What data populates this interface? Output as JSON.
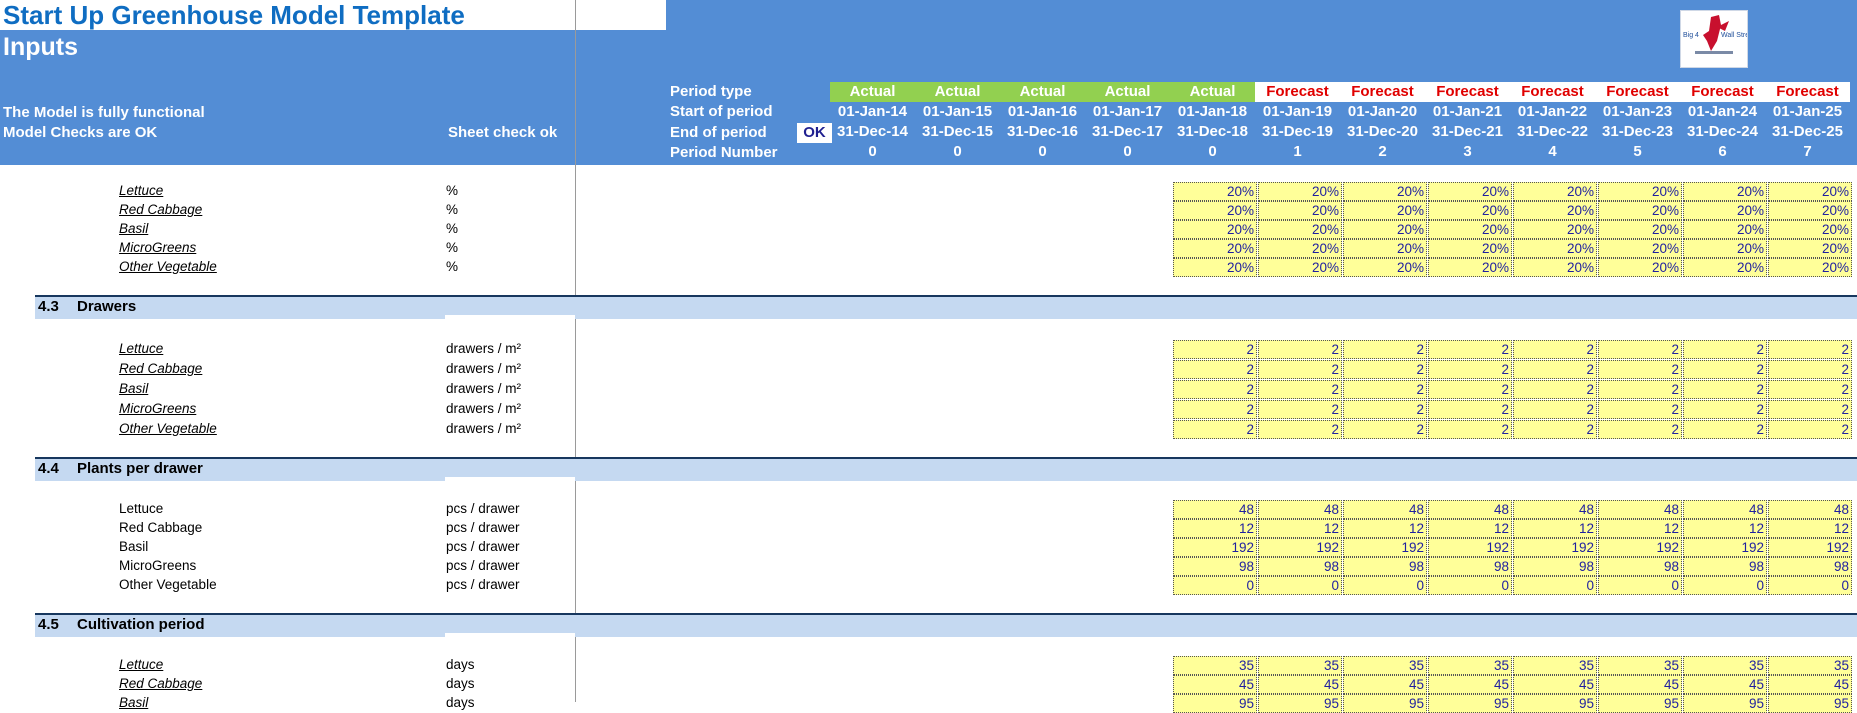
{
  "header": {
    "title": "Start Up Greenhouse Model Template",
    "subtitle": "Inputs",
    "status_line1": "The Model is fully functional",
    "status_line2": "Model Checks are OK",
    "sheet_check": "Sheet check ok",
    "ok_badge": "OK",
    "logo_text": "Big 4 Wall Street"
  },
  "timeline": {
    "row_labels": {
      "period_type": "Period type",
      "start": "Start of period",
      "end": "End of period",
      "number": "Period Number"
    },
    "columns": [
      {
        "type": "Actual",
        "start": "01-Jan-14",
        "end": "31-Dec-14",
        "num": "0"
      },
      {
        "type": "Actual",
        "start": "01-Jan-15",
        "end": "31-Dec-15",
        "num": "0"
      },
      {
        "type": "Actual",
        "start": "01-Jan-16",
        "end": "31-Dec-16",
        "num": "0"
      },
      {
        "type": "Actual",
        "start": "01-Jan-17",
        "end": "31-Dec-17",
        "num": "0"
      },
      {
        "type": "Actual",
        "start": "01-Jan-18",
        "end": "31-Dec-18",
        "num": "0"
      },
      {
        "type": "Forecast",
        "start": "01-Jan-19",
        "end": "31-Dec-19",
        "num": "1"
      },
      {
        "type": "Forecast",
        "start": "01-Jan-20",
        "end": "31-Dec-20",
        "num": "2"
      },
      {
        "type": "Forecast",
        "start": "01-Jan-21",
        "end": "31-Dec-21",
        "num": "3"
      },
      {
        "type": "Forecast",
        "start": "01-Jan-22",
        "end": "31-Dec-22",
        "num": "4"
      },
      {
        "type": "Forecast",
        "start": "01-Jan-23",
        "end": "31-Dec-23",
        "num": "5"
      },
      {
        "type": "Forecast",
        "start": "01-Jan-24",
        "end": "31-Dec-24",
        "num": "6"
      },
      {
        "type": "Forecast",
        "start": "01-Jan-25",
        "end": "31-Dec-25",
        "num": "7"
      }
    ]
  },
  "sections": [
    {
      "number": "",
      "title": "",
      "rows": [
        {
          "label": "Lettuce",
          "link": true,
          "unit": "%",
          "values": [
            "20%",
            "20%",
            "20%",
            "20%",
            "20%",
            "20%",
            "20%",
            "20%"
          ]
        },
        {
          "label": "Red Cabbage",
          "link": true,
          "unit": "%",
          "values": [
            "20%",
            "20%",
            "20%",
            "20%",
            "20%",
            "20%",
            "20%",
            "20%"
          ]
        },
        {
          "label": "Basil",
          "link": true,
          "unit": "%",
          "values": [
            "20%",
            "20%",
            "20%",
            "20%",
            "20%",
            "20%",
            "20%",
            "20%"
          ]
        },
        {
          "label": "MicroGreens",
          "link": true,
          "unit": "%",
          "values": [
            "20%",
            "20%",
            "20%",
            "20%",
            "20%",
            "20%",
            "20%",
            "20%"
          ]
        },
        {
          "label": "Other Vegetable",
          "link": true,
          "unit": "%",
          "values": [
            "20%",
            "20%",
            "20%",
            "20%",
            "20%",
            "20%",
            "20%",
            "20%"
          ]
        }
      ]
    },
    {
      "number": "4.3",
      "title": "Drawers",
      "rows": [
        {
          "label": "Lettuce",
          "link": true,
          "unit": "drawers / m²",
          "values": [
            "2",
            "2",
            "2",
            "2",
            "2",
            "2",
            "2",
            "2"
          ]
        },
        {
          "label": "Red Cabbage",
          "link": true,
          "unit": "drawers / m²",
          "values": [
            "2",
            "2",
            "2",
            "2",
            "2",
            "2",
            "2",
            "2"
          ]
        },
        {
          "label": "Basil",
          "link": true,
          "unit": "drawers / m²",
          "values": [
            "2",
            "2",
            "2",
            "2",
            "2",
            "2",
            "2",
            "2"
          ]
        },
        {
          "label": "MicroGreens",
          "link": true,
          "unit": "drawers / m²",
          "values": [
            "2",
            "2",
            "2",
            "2",
            "2",
            "2",
            "2",
            "2"
          ]
        },
        {
          "label": "Other Vegetable",
          "link": true,
          "unit": "drawers / m²",
          "values": [
            "2",
            "2",
            "2",
            "2",
            "2",
            "2",
            "2",
            "2"
          ]
        }
      ]
    },
    {
      "number": "4.4",
      "title": "Plants per drawer",
      "rows": [
        {
          "label": "Lettuce",
          "link": false,
          "unit": "pcs / drawer",
          "values": [
            "48",
            "48",
            "48",
            "48",
            "48",
            "48",
            "48",
            "48"
          ]
        },
        {
          "label": "Red Cabbage",
          "link": false,
          "unit": "pcs / drawer",
          "values": [
            "12",
            "12",
            "12",
            "12",
            "12",
            "12",
            "12",
            "12"
          ]
        },
        {
          "label": "Basil",
          "link": false,
          "unit": "pcs / drawer",
          "values": [
            "192",
            "192",
            "192",
            "192",
            "192",
            "192",
            "192",
            "192"
          ]
        },
        {
          "label": "MicroGreens",
          "link": false,
          "unit": "pcs / drawer",
          "values": [
            "98",
            "98",
            "98",
            "98",
            "98",
            "98",
            "98",
            "98"
          ]
        },
        {
          "label": "Other Vegetable",
          "link": false,
          "unit": "pcs / drawer",
          "values": [
            "0",
            "0",
            "0",
            "0",
            "0",
            "0",
            "0",
            "0"
          ]
        }
      ]
    },
    {
      "number": "4.5",
      "title": "Cultivation period",
      "rows": [
        {
          "label": "Lettuce",
          "link": true,
          "unit": "days",
          "values": [
            "35",
            "35",
            "35",
            "35",
            "35",
            "35",
            "35",
            "35"
          ]
        },
        {
          "label": "Red Cabbage",
          "link": true,
          "unit": "days",
          "values": [
            "45",
            "45",
            "45",
            "45",
            "45",
            "45",
            "45",
            "45"
          ]
        },
        {
          "label": "Basil",
          "link": true,
          "unit": "days",
          "values": [
            "95",
            "95",
            "95",
            "95",
            "95",
            "95",
            "95",
            "95"
          ]
        }
      ]
    }
  ],
  "colors": {
    "header_bg": "#538DD5",
    "title": "#0F6DC2",
    "actual_bg": "#92D050",
    "forecast_text": "#E00000",
    "section_bg": "#C5D9F1",
    "input_bg": "#FFFF99",
    "input_text": "#1F1FA0"
  }
}
